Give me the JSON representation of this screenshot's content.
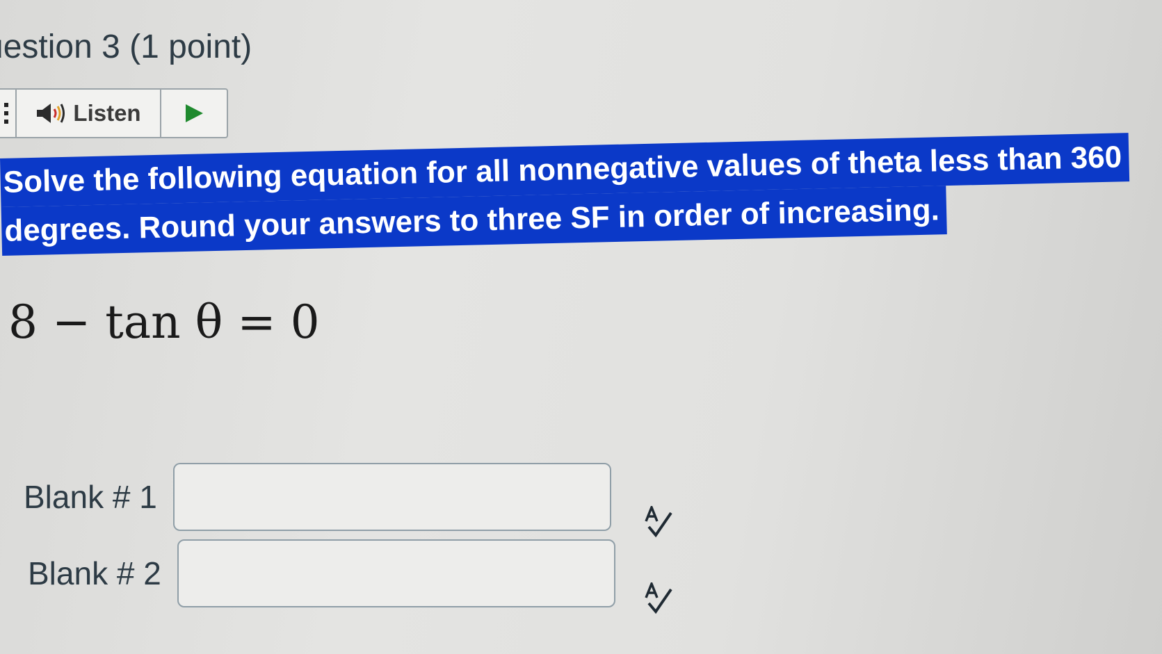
{
  "question": {
    "title": "uestion 3 (1 point)"
  },
  "listen_bar": {
    "listen_label": "Listen"
  },
  "prompt": {
    "line1": "Solve the following equation for all nonnegative values of theta less than 360",
    "line2": "degrees. Round your answers to three SF in order of increasing."
  },
  "equation": {
    "text": "8 − tan θ = 0"
  },
  "blanks": [
    {
      "label": "Blank # 1",
      "value": ""
    },
    {
      "label": "Blank # 2",
      "value": ""
    }
  ],
  "colors": {
    "highlight": "#0b39c8",
    "play_green": "#1f8a2e",
    "text": "#2d3b45"
  },
  "icons": {
    "speaker": "speaker-icon",
    "play": "play-icon",
    "spellcheck": "spellcheck-icon"
  }
}
